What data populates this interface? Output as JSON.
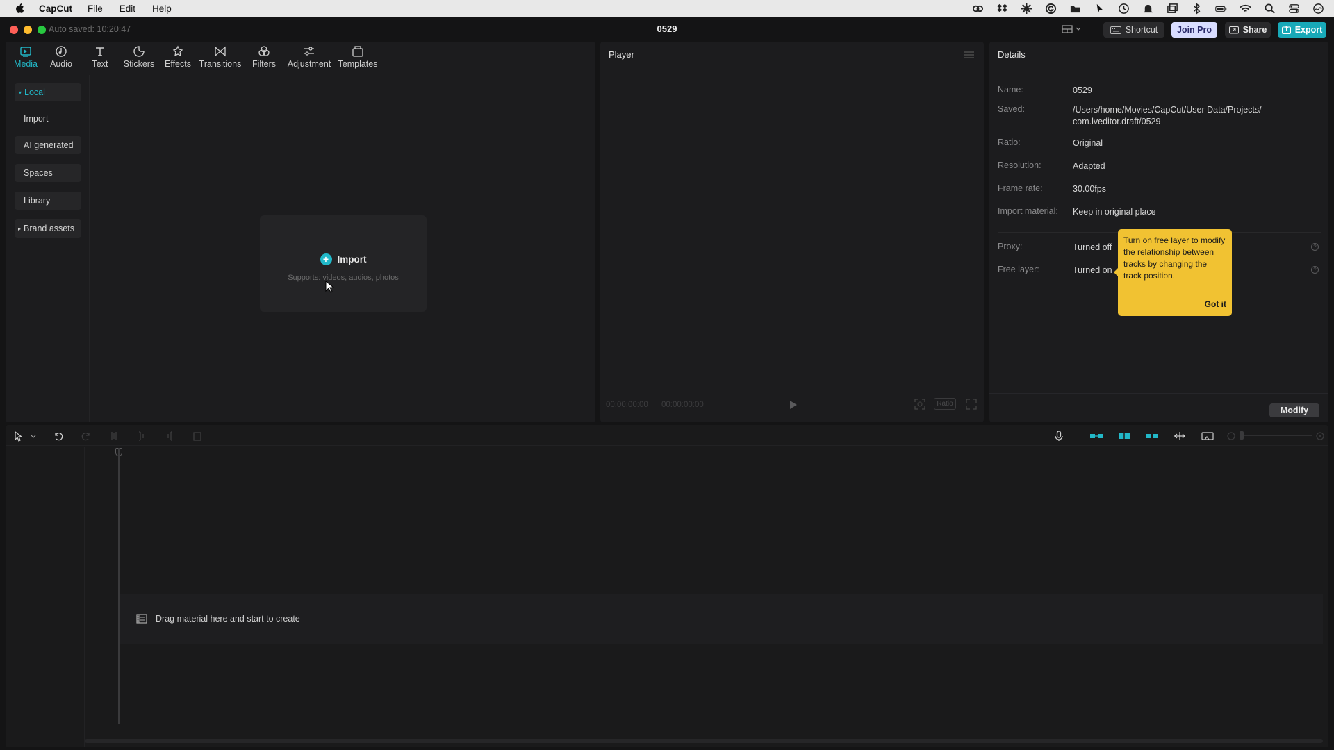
{
  "menubar": {
    "app_name": "CapCut",
    "items": [
      "File",
      "Edit",
      "Help"
    ],
    "tray_icons": [
      "creative-cloud-icon",
      "dropbox-icon",
      "settings-gear-icon",
      "grammarly-icon",
      "folder-icon",
      "cursor-icon",
      "clock-icon",
      "notifications-icon",
      "window-icon",
      "bluetooth-icon",
      "battery-icon",
      "wifi-icon",
      "search-icon",
      "control-center-icon",
      "siri-icon"
    ]
  },
  "window": {
    "autosave": "Auto saved: 10:20:47",
    "title": "0529",
    "buttons": {
      "shortcut": "Shortcut",
      "join_pro": "Join Pro",
      "share": "Share",
      "export": "Export"
    }
  },
  "media": {
    "tabs": [
      {
        "label": "Media",
        "icon": "media-icon"
      },
      {
        "label": "Audio",
        "icon": "audio-icon"
      },
      {
        "label": "Text",
        "icon": "text-icon"
      },
      {
        "label": "Stickers",
        "icon": "stickers-icon"
      },
      {
        "label": "Effects",
        "icon": "effects-icon"
      },
      {
        "label": "Transitions",
        "icon": "transitions-icon"
      },
      {
        "label": "Filters",
        "icon": "filters-icon"
      },
      {
        "label": "Adjustment",
        "icon": "adjustment-icon"
      },
      {
        "label": "Templates",
        "icon": "templates-icon"
      }
    ],
    "sidebar": [
      "Local",
      "Import",
      "AI generated",
      "Spaces",
      "Library",
      "Brand assets"
    ],
    "import_label": "Import",
    "import_sub": "Supports: videos, audios, photos"
  },
  "player": {
    "title": "Player",
    "current_time": "00:00:00:00",
    "duration": "00:00:00:00",
    "ratio_label": "Ratio"
  },
  "details": {
    "title": "Details",
    "rows": [
      {
        "key": "Name:",
        "value": "0529"
      },
      {
        "key": "Saved:",
        "value": "/Users/home/Movies/CapCut/User Data/Projects/ com.lveditor.draft/0529"
      },
      {
        "key": "Ratio:",
        "value": "Original"
      },
      {
        "key": "Resolution:",
        "value": "Adapted"
      },
      {
        "key": "Frame rate:",
        "value": "30.00fps"
      },
      {
        "key": "Import material:",
        "value": "Keep in original place"
      },
      {
        "key": "Proxy:",
        "value": "Turned off"
      },
      {
        "key": "Free layer:",
        "value": "Turned on"
      }
    ],
    "tooltip": {
      "text": "Turn on free layer to modify the relationship between tracks by changing the track position.",
      "button": "Got it"
    },
    "modify_label": "Modify"
  },
  "timeline": {
    "drag_hint": "Drag material here and start to create"
  },
  "colors": {
    "accent": "#22b8c8",
    "tooltip": "#f1c232",
    "join_pro": "#d9ddff"
  }
}
